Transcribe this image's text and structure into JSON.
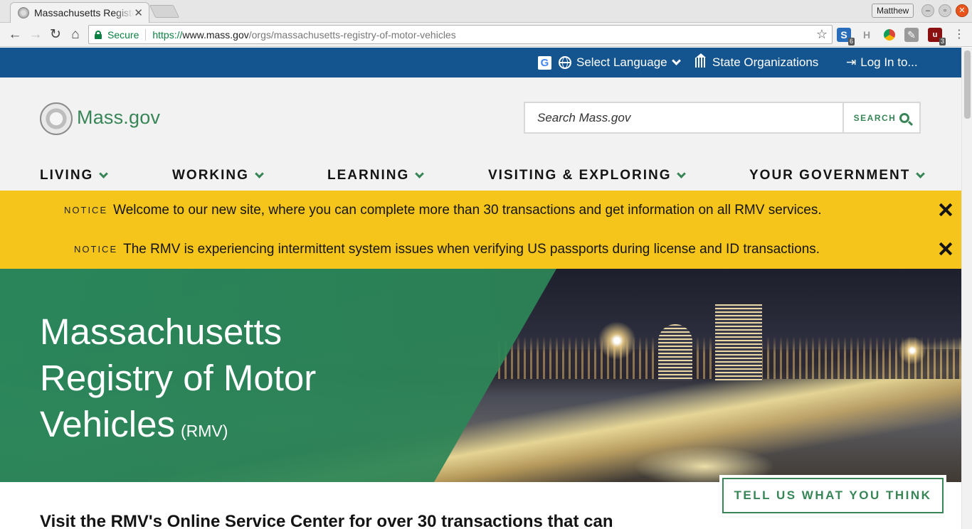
{
  "browser": {
    "tab_title": "Massachusetts Registry of Motor Vehicles",
    "profile_name": "Matthew",
    "secure_label": "Secure",
    "url_scheme": "https://",
    "url_host": "www.mass.gov",
    "url_path": "/orgs/massachusetts-registry-of-motor-vehicles",
    "extensions": [
      {
        "icon": "sticky-notes-extension-icon",
        "label": "S",
        "badge": "6"
      },
      {
        "icon": "h-extension-icon",
        "label": "H"
      },
      {
        "icon": "chrome-color-extension-icon"
      },
      {
        "icon": "pen-extension-icon",
        "label": "✎"
      },
      {
        "icon": "ublock-extension-icon",
        "label": "u",
        "badge": "3"
      }
    ]
  },
  "utility_bar": {
    "select_language": "Select Language",
    "state_organizations": "State Organizations",
    "log_in": "Log In to..."
  },
  "header": {
    "logo_text": "Mass.gov",
    "search_placeholder": "Search Mass.gov",
    "search_button": "SEARCH"
  },
  "main_nav": [
    {
      "label": "LIVING"
    },
    {
      "label": "WORKING"
    },
    {
      "label": "LEARNING"
    },
    {
      "label": "VISITING & EXPLORING"
    },
    {
      "label": "YOUR GOVERNMENT"
    }
  ],
  "notices": [
    {
      "label": "NOTICE",
      "text": "Welcome to our new site, where you can complete more than 30 transactions and get information on all RMV services."
    },
    {
      "label": "NOTICE",
      "text": "The RMV is experiencing intermittent system issues when verifying US passports during license and ID transactions."
    }
  ],
  "hero": {
    "title_line1": "Massachusetts",
    "title_line2": "Registry of Motor",
    "title_line3": "Vehicles",
    "abbreviation": "(RMV)"
  },
  "content": {
    "heading": "Visit the RMV's Online Service Center for over 30 transactions that can"
  },
  "feedback_button": "TELL US WHAT YOU THINK",
  "colors": {
    "utility_bar": "#14558f",
    "brand_green": "#388557",
    "notice_yellow": "#f6c51b",
    "header_bg": "#f2f2f2"
  }
}
